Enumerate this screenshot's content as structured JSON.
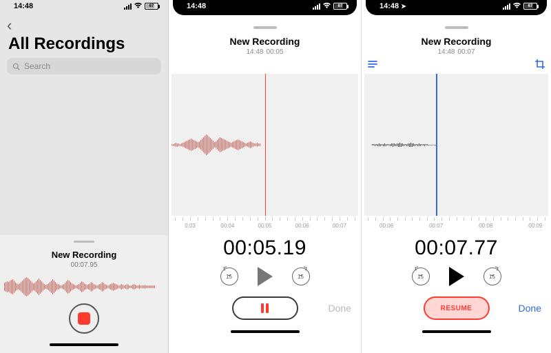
{
  "status": {
    "time": "14:48",
    "battery": "67"
  },
  "pane1": {
    "title": "All Recordings",
    "search_placeholder": "Search",
    "rec_title": "New Recording",
    "rec_time": "00:07.95"
  },
  "pane2": {
    "rec_title": "New Recording",
    "rec_ts": "14:48",
    "rec_dur": "00:05",
    "ticks": [
      "0:03",
      "00:04",
      "00:05",
      "00:06",
      "00:07"
    ],
    "tick_pos": [
      10,
      30,
      50,
      70,
      90
    ],
    "big_time": "00:05.19",
    "skip": "15",
    "done": "Done",
    "playhead_pct": 50,
    "wave_fill_pct": 50
  },
  "pane3": {
    "rec_title": "New Recording",
    "rec_ts": "14:48",
    "rec_dur": "00:07",
    "ticks": [
      "00:06",
      "00:07",
      "00:08",
      "00:09"
    ],
    "tick_pos": [
      12,
      39,
      66,
      93
    ],
    "big_time": "00:07.77",
    "skip": "15",
    "resume": "RESUME",
    "done": "Done",
    "playhead_pct": 39,
    "dots_from": 5,
    "dots_to": 39
  }
}
